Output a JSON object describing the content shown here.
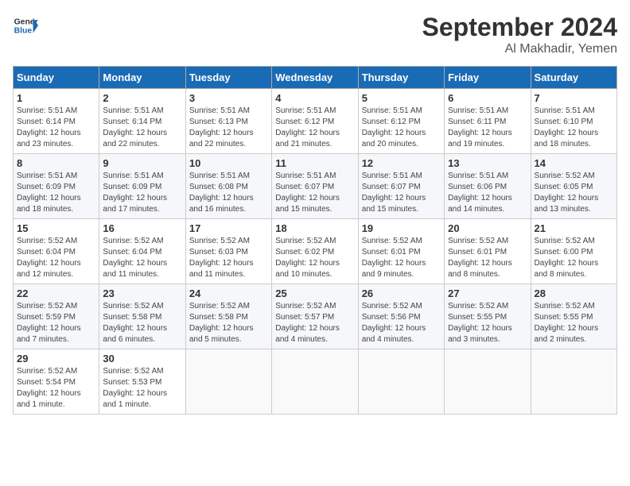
{
  "header": {
    "logo_general": "General",
    "logo_blue": "Blue",
    "month": "September 2024",
    "location": "Al Makhadir, Yemen"
  },
  "days_of_week": [
    "Sunday",
    "Monday",
    "Tuesday",
    "Wednesday",
    "Thursday",
    "Friday",
    "Saturday"
  ],
  "weeks": [
    [
      {
        "day": "1",
        "sunrise": "5:51 AM",
        "sunset": "6:14 PM",
        "daylight": "12 hours and 23 minutes."
      },
      {
        "day": "2",
        "sunrise": "5:51 AM",
        "sunset": "6:14 PM",
        "daylight": "12 hours and 22 minutes."
      },
      {
        "day": "3",
        "sunrise": "5:51 AM",
        "sunset": "6:13 PM",
        "daylight": "12 hours and 22 minutes."
      },
      {
        "day": "4",
        "sunrise": "5:51 AM",
        "sunset": "6:12 PM",
        "daylight": "12 hours and 21 minutes."
      },
      {
        "day": "5",
        "sunrise": "5:51 AM",
        "sunset": "6:12 PM",
        "daylight": "12 hours and 20 minutes."
      },
      {
        "day": "6",
        "sunrise": "5:51 AM",
        "sunset": "6:11 PM",
        "daylight": "12 hours and 19 minutes."
      },
      {
        "day": "7",
        "sunrise": "5:51 AM",
        "sunset": "6:10 PM",
        "daylight": "12 hours and 18 minutes."
      }
    ],
    [
      {
        "day": "8",
        "sunrise": "5:51 AM",
        "sunset": "6:09 PM",
        "daylight": "12 hours and 18 minutes."
      },
      {
        "day": "9",
        "sunrise": "5:51 AM",
        "sunset": "6:09 PM",
        "daylight": "12 hours and 17 minutes."
      },
      {
        "day": "10",
        "sunrise": "5:51 AM",
        "sunset": "6:08 PM",
        "daylight": "12 hours and 16 minutes."
      },
      {
        "day": "11",
        "sunrise": "5:51 AM",
        "sunset": "6:07 PM",
        "daylight": "12 hours and 15 minutes."
      },
      {
        "day": "12",
        "sunrise": "5:51 AM",
        "sunset": "6:07 PM",
        "daylight": "12 hours and 15 minutes."
      },
      {
        "day": "13",
        "sunrise": "5:51 AM",
        "sunset": "6:06 PM",
        "daylight": "12 hours and 14 minutes."
      },
      {
        "day": "14",
        "sunrise": "5:52 AM",
        "sunset": "6:05 PM",
        "daylight": "12 hours and 13 minutes."
      }
    ],
    [
      {
        "day": "15",
        "sunrise": "5:52 AM",
        "sunset": "6:04 PM",
        "daylight": "12 hours and 12 minutes."
      },
      {
        "day": "16",
        "sunrise": "5:52 AM",
        "sunset": "6:04 PM",
        "daylight": "12 hours and 11 minutes."
      },
      {
        "day": "17",
        "sunrise": "5:52 AM",
        "sunset": "6:03 PM",
        "daylight": "12 hours and 11 minutes."
      },
      {
        "day": "18",
        "sunrise": "5:52 AM",
        "sunset": "6:02 PM",
        "daylight": "12 hours and 10 minutes."
      },
      {
        "day": "19",
        "sunrise": "5:52 AM",
        "sunset": "6:01 PM",
        "daylight": "12 hours and 9 minutes."
      },
      {
        "day": "20",
        "sunrise": "5:52 AM",
        "sunset": "6:01 PM",
        "daylight": "12 hours and 8 minutes."
      },
      {
        "day": "21",
        "sunrise": "5:52 AM",
        "sunset": "6:00 PM",
        "daylight": "12 hours and 8 minutes."
      }
    ],
    [
      {
        "day": "22",
        "sunrise": "5:52 AM",
        "sunset": "5:59 PM",
        "daylight": "12 hours and 7 minutes."
      },
      {
        "day": "23",
        "sunrise": "5:52 AM",
        "sunset": "5:58 PM",
        "daylight": "12 hours and 6 minutes."
      },
      {
        "day": "24",
        "sunrise": "5:52 AM",
        "sunset": "5:58 PM",
        "daylight": "12 hours and 5 minutes."
      },
      {
        "day": "25",
        "sunrise": "5:52 AM",
        "sunset": "5:57 PM",
        "daylight": "12 hours and 4 minutes."
      },
      {
        "day": "26",
        "sunrise": "5:52 AM",
        "sunset": "5:56 PM",
        "daylight": "12 hours and 4 minutes."
      },
      {
        "day": "27",
        "sunrise": "5:52 AM",
        "sunset": "5:55 PM",
        "daylight": "12 hours and 3 minutes."
      },
      {
        "day": "28",
        "sunrise": "5:52 AM",
        "sunset": "5:55 PM",
        "daylight": "12 hours and 2 minutes."
      }
    ],
    [
      {
        "day": "29",
        "sunrise": "5:52 AM",
        "sunset": "5:54 PM",
        "daylight": "12 hours and 1 minute."
      },
      {
        "day": "30",
        "sunrise": "5:52 AM",
        "sunset": "5:53 PM",
        "daylight": "12 hours and 1 minute."
      },
      null,
      null,
      null,
      null,
      null
    ]
  ],
  "labels": {
    "sunrise_prefix": "Sunrise: ",
    "sunset_prefix": "Sunset: ",
    "daylight_prefix": "Daylight: "
  }
}
